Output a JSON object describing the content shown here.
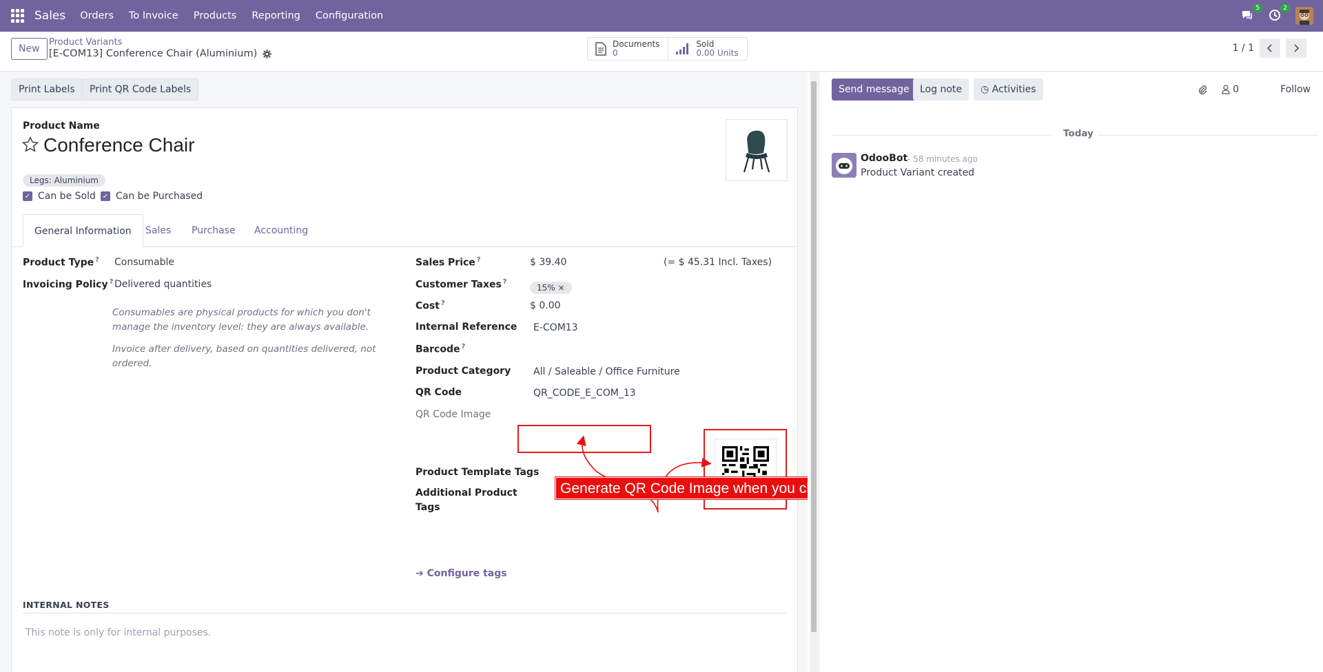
{
  "navbar": {
    "app_name": "Sales",
    "menu": [
      "Orders",
      "To Invoice",
      "Products",
      "Reporting",
      "Configuration"
    ],
    "messages_badge": "5",
    "activities_badge": "2"
  },
  "control": {
    "new_label": "New",
    "breadcrumb_parent": "Product Variants",
    "breadcrumb_current": "[E-COM13] Conference Chair (Aluminium)",
    "documents_label": "Documents",
    "documents_value": "0",
    "sold_label": "Sold",
    "sold_value": "0.00 Units",
    "pager": "1 / 1"
  },
  "actions": {
    "print_labels": "Print Labels",
    "print_qr": "Print QR Code Labels"
  },
  "form": {
    "product_name_label": "Product Name",
    "product_name": "Conference Chair",
    "variant_tag": "Legs: Aluminium",
    "can_be_sold": "Can be Sold",
    "can_be_purchased": "Can be Purchased",
    "tabs": [
      "General Information",
      "Sales",
      "Purchase",
      "Accounting"
    ],
    "product_type_label": "Product Type",
    "product_type": "Consumable",
    "invoicing_policy_label": "Invoicing Policy",
    "invoicing_policy": "Delivered quantities",
    "help_consumable": "Consumables are physical products for which you don't manage the inventory level: they are always available.",
    "help_invoice": "Invoice after delivery, based on quantities delivered, not ordered.",
    "sales_price_label": "Sales Price",
    "sales_price": "$ 39.40",
    "incl_taxes": "(= $ 45.31 Incl. Taxes)",
    "customer_taxes_label": "Customer Taxes",
    "customer_tax_tag": "15%",
    "cost_label": "Cost",
    "cost": "$ 0.00",
    "internal_ref_label": "Internal Reference",
    "internal_ref": "E-COM13",
    "barcode_label": "Barcode",
    "category_label": "Product Category",
    "category": "All / Saleable / Office Furniture",
    "qr_code_label": "QR Code",
    "qr_code": "QR_CODE_E_COM_13",
    "qr_image_label": "QR Code Image",
    "template_tags_label": "Product Template Tags",
    "additional_tags_label_1": "Additional Product",
    "additional_tags_label_2": "Tags",
    "configure_tags": "Configure tags",
    "internal_notes_title": "INTERNAL NOTES",
    "internal_notes_placeholder": "This note is only for internal purposes."
  },
  "annotation": "Generate QR Code Image when you change QR Code manually",
  "chatter": {
    "send_message": "Send message",
    "log_note": "Log note",
    "activities": "Activities",
    "followers_count": "0",
    "follow": "Follow",
    "today": "Today",
    "author": "OdooBot",
    "time": "- 58 minutes ago",
    "body": "Product Variant created"
  },
  "colors": {
    "brand": "#71639e",
    "annotation": "#e80f0f"
  }
}
